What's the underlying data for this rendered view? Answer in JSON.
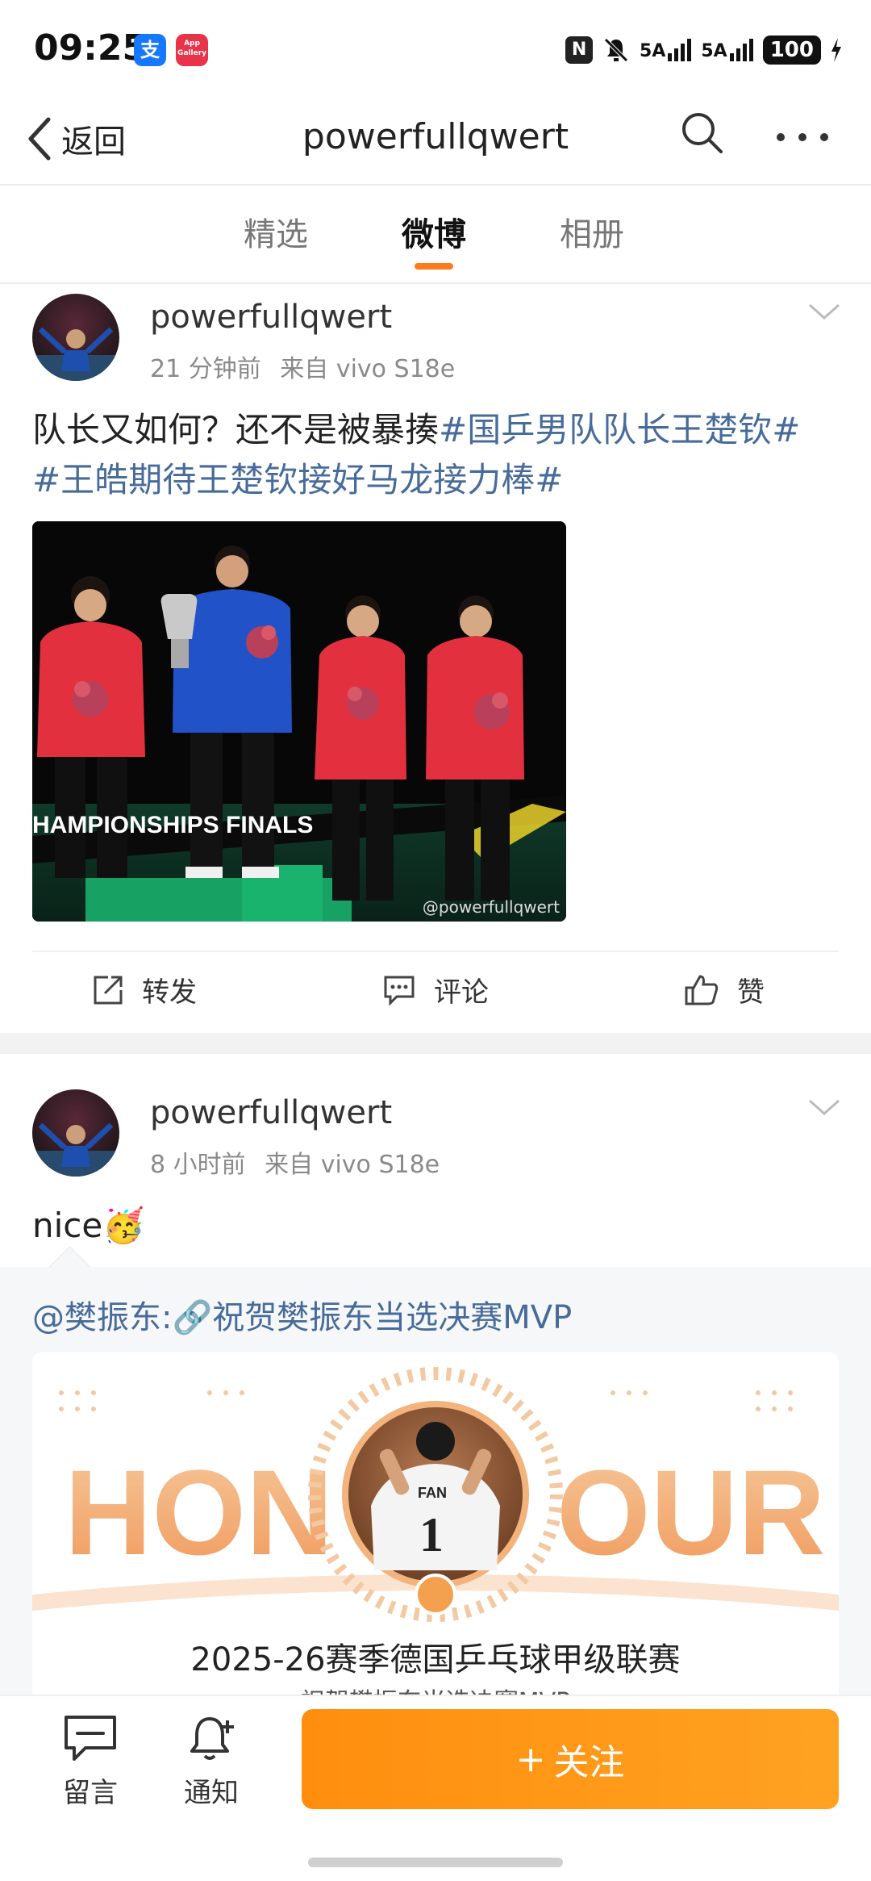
{
  "status_bar": {
    "time": "09:25",
    "alipay_glyph": "支",
    "gallery_label": "App Gallery",
    "nfc_glyph": "N",
    "network1": "5A",
    "network2": "5A",
    "battery": "100"
  },
  "nav": {
    "back_label": "返回",
    "title": "powerfullqwert",
    "icons": [
      "back-chevron-icon",
      "search-icon",
      "more-icon"
    ]
  },
  "tabs": [
    {
      "label": "精选",
      "active": false
    },
    {
      "label": "微博",
      "active": true
    },
    {
      "label": "相册",
      "active": false
    }
  ],
  "accent_color": "#ff7a1a",
  "posts": [
    {
      "username": "powerfullqwert",
      "time": "21 分钟前",
      "source_prefix": "来自",
      "source": "vivo S18e",
      "text_plain": "队长又如何？还不是被暴揍",
      "tag1": "#国乒男队队长王楚钦#",
      "tag2": "#王皓期待王楚钦接好马龙接力棒#",
      "image": {
        "banner_text": "HAMPIONSHIPS FINALS",
        "watermark": "@powerfullqwert"
      },
      "actions": {
        "repost": "转发",
        "comment": "评论",
        "like": "赞"
      }
    },
    {
      "username": "powerfullqwert",
      "time": "8 小时前",
      "source_prefix": "来自",
      "source": "vivo S18e",
      "text": "nice",
      "emoji": "🥳",
      "repost_line": "@樊振东:🔗祝贺樊振东当选决赛MVP",
      "card": {
        "word_left": "HON",
        "word_right": "OUR",
        "jersey_name": "FAN",
        "jersey_number": "1",
        "caption": "2025-26赛季德国乒乓球甲级联赛",
        "subcaption": "祝贺樊振东当选决赛MVP"
      }
    }
  ],
  "bottom_bar": {
    "message_label": "留言",
    "notify_label": "通知",
    "follow_label": "关注",
    "follow_plus": "+"
  }
}
